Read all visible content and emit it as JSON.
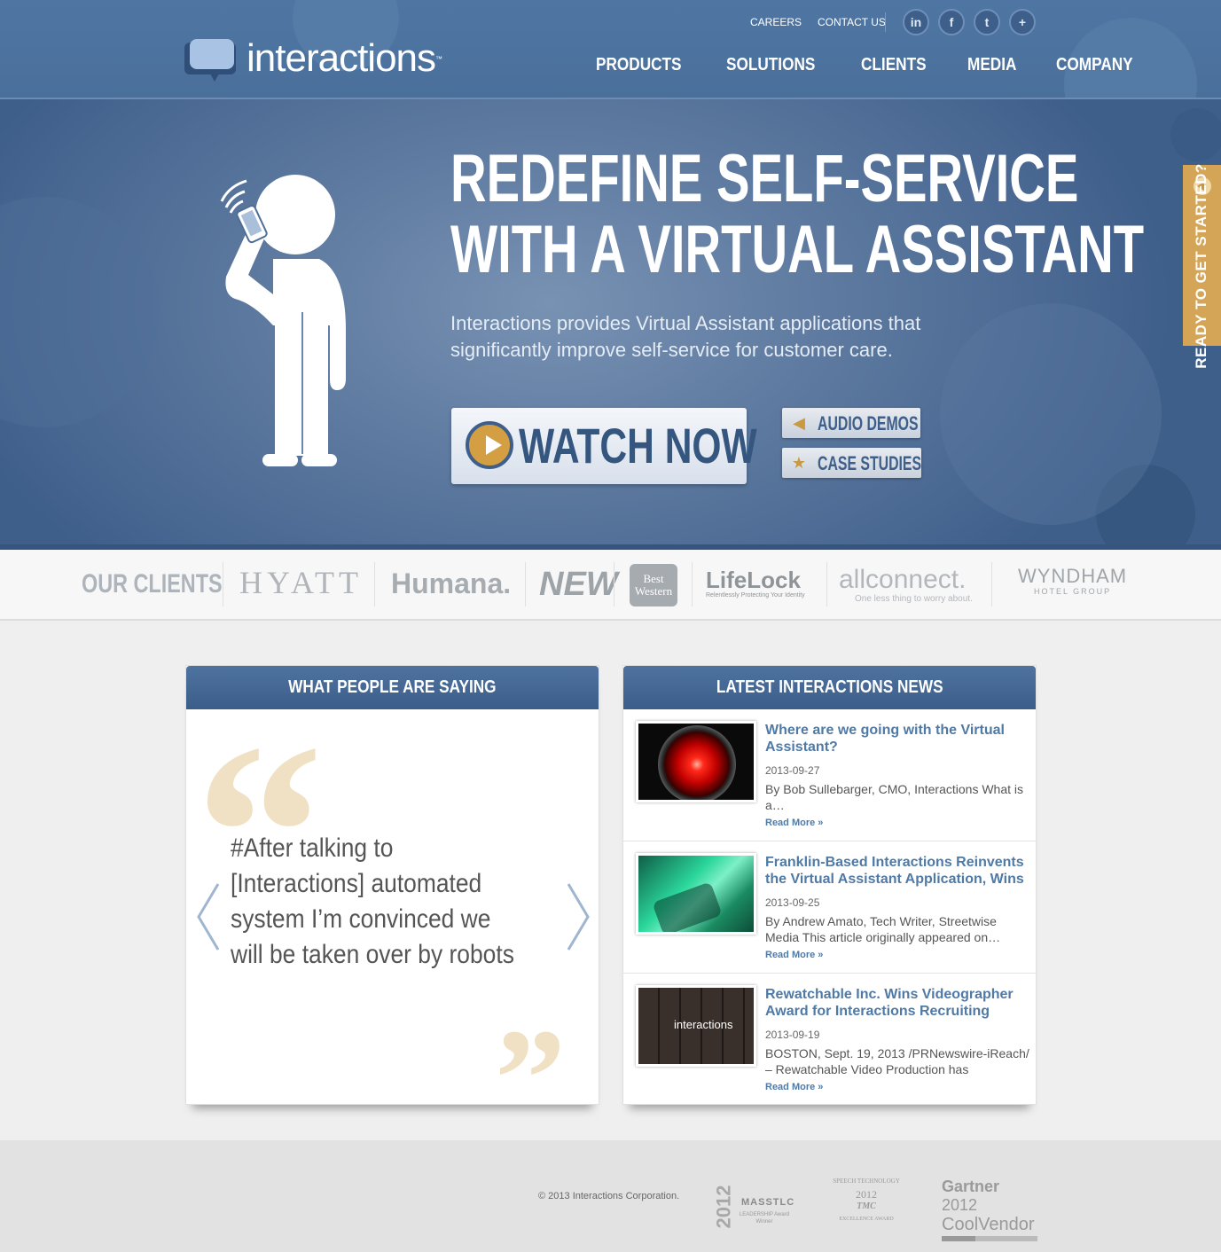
{
  "header": {
    "logo_text": "interactions",
    "logo_tm": "™",
    "top_links": [
      "CAREERS",
      "CONTACT US"
    ],
    "social": [
      "in",
      "f",
      "t",
      "+"
    ],
    "nav": [
      "PRODUCTS",
      "SOLUTIONS",
      "CLIENTS",
      "MEDIA",
      "COMPANY"
    ]
  },
  "hero": {
    "headline_line1": "REDEFINE SELF-SERVICE",
    "headline_line2": "WITH A VIRTUAL ASSISTANT",
    "subtext": "Interactions provides Virtual Assistant applications that significantly improve self-service for customer care.",
    "watch_label": "WATCH NOW",
    "audio_label": "AUDIO DEMOS",
    "case_label": "CASE STUDIES",
    "side_tab": "READY TO GET STARTED?"
  },
  "clients": {
    "title": "OUR CLIENTS",
    "logos": [
      "HYATT",
      "Humana.",
      "NEW",
      "Best Western",
      "LifeLock",
      "allconnect.",
      "WYNDHAM"
    ],
    "lifelock_tagline": "Relentlessly Protecting Your Identity",
    "allconnect_tagline": "One less thing to worry about.",
    "wyndham_sub": "HOTEL GROUP"
  },
  "testimonials": {
    "heading": "WHAT PEOPLE ARE SAYING",
    "quote": "#After talking to [Interactions] automated system I’m convinced we will be taken over by robots"
  },
  "news": {
    "heading": "LATEST INTERACTIONS NEWS",
    "items": [
      {
        "title": "Where are we going with the Virtual Assistant?",
        "date": "2013-09-27",
        "excerpt": "By Bob Sullebarger, CMO, Interactions What is a…",
        "more": "Read More »"
      },
      {
        "title": "Franklin-Based Interactions Reinvents the Virtual Assistant Application, Wins",
        "date": "2013-09-25",
        "excerpt": "By Andrew Amato, Tech Writer, Streetwise Media   This article originally appeared on…",
        "more": "Read More »"
      },
      {
        "title": "Rewatchable Inc. Wins Videographer Award for Interactions Recruiting",
        "date": "2013-09-19",
        "excerpt": "BOSTON, Sept. 19, 2013 /PRNewswire-iReach/ – Rewatchable Video Production has",
        "more": "Read More »",
        "thumb_text": "interactions"
      }
    ]
  },
  "footer": {
    "copyright": "© 2013 Interactions Corporation.",
    "awards": {
      "massTLC_year": "2012",
      "massTLC_name": "MASSTLC",
      "massTLC_sub": "LEADERSHIP Award Winner",
      "speech_top": "SPEECH TECHNOLOGY",
      "speech_year": "2012",
      "speech_mark": "TMC",
      "speech_bottom": "EXCELLENCE AWARD",
      "gartner_name": "Gartner",
      "gartner_year": "2012",
      "gartner_sub": "CoolVendor"
    }
  },
  "colors": {
    "brand_blue": "#4a6f9b",
    "accent_gold": "#d4a457",
    "link_blue": "#4f7aa6"
  }
}
